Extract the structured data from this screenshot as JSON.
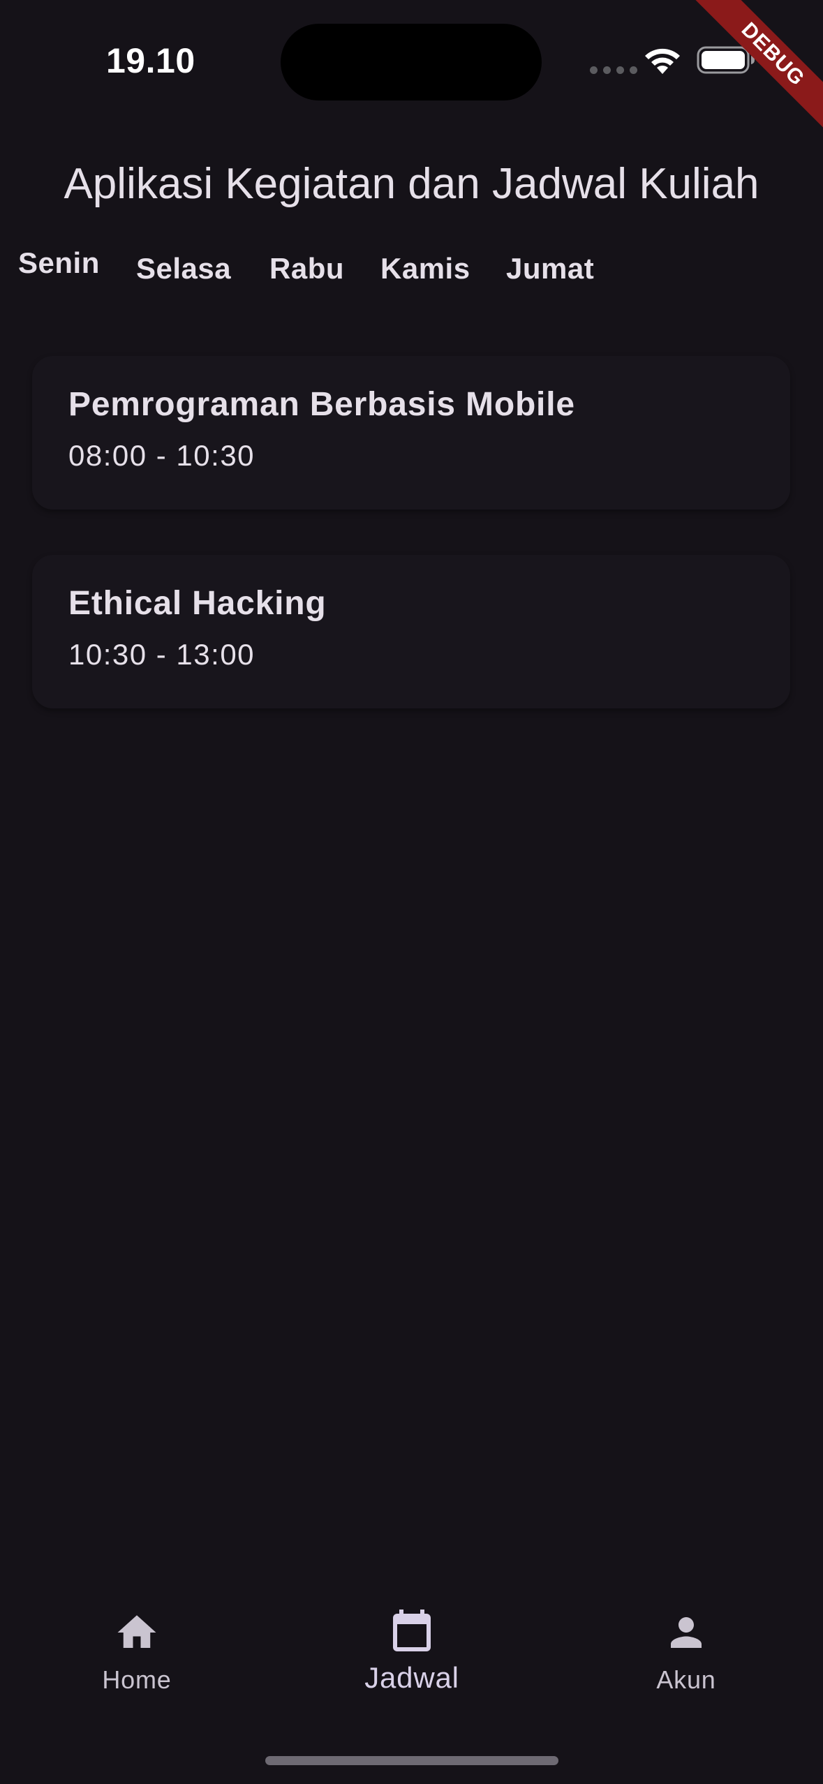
{
  "status_bar": {
    "time": "19.10"
  },
  "debug_banner": {
    "label": "DEBUG"
  },
  "header": {
    "title": "Aplikasi Kegiatan dan Jadwal Kuliah"
  },
  "day_tabs": [
    {
      "label": "Senin"
    },
    {
      "label": "Selasa"
    },
    {
      "label": "Rabu"
    },
    {
      "label": "Kamis"
    },
    {
      "label": "Jumat"
    }
  ],
  "schedule": [
    {
      "course": "Pemrograman Berbasis Mobile",
      "time": "08:00 - 10:30"
    },
    {
      "course": "Ethical Hacking",
      "time": "10:30 - 13:00"
    }
  ],
  "bottom_nav": {
    "items": [
      {
        "label": "Home",
        "icon": "home-icon"
      },
      {
        "label": "Jadwal",
        "icon": "calendar-icon",
        "selected": true
      },
      {
        "label": "Akun",
        "icon": "person-icon"
      }
    ]
  },
  "colors": {
    "background": "#151218",
    "card": "#18151c",
    "text": "#e6e0e9",
    "nav_label": "#cac4d0",
    "selected": "#d9d1e8",
    "debug": "#8b1a1a"
  }
}
